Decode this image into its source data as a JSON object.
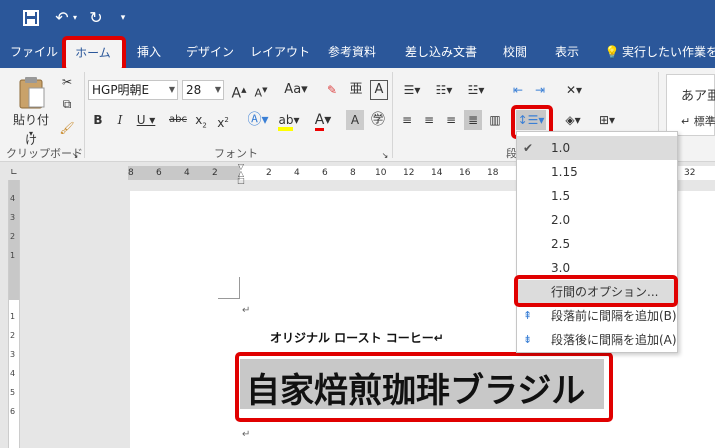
{
  "tabs": [
    "ファイル",
    "ホーム",
    "挿入",
    "デザイン",
    "レイアウト",
    "参考資料",
    "差し込み文書",
    "校閲",
    "表示"
  ],
  "tell_me": "実行したい作業を",
  "clipboard": {
    "paste_label": "貼り付け",
    "group_label": "クリップボード"
  },
  "font": {
    "name": "HGP明朝E",
    "size": "28",
    "group_label": "フォント"
  },
  "paragraph_group_label_partial": "段",
  "styles_preview": {
    "sample": "あア亜",
    "name": "↵ 標準"
  },
  "line_spacing_menu": {
    "options": [
      "1.0",
      "1.15",
      "1.5",
      "2.0",
      "2.5",
      "3.0"
    ],
    "checked": "1.0",
    "line_spacing_options": "行間のオプション...",
    "add_space_before": "段落前に間隔を追加(B)",
    "add_space_after": "段落後に間隔を追加(A)"
  },
  "ruler": {
    "top_left_numbers": [
      "8",
      "6",
      "4",
      "2"
    ],
    "top_right_numbers": [
      "2",
      "4",
      "6",
      "8",
      "10",
      "12",
      "14",
      "16",
      "18"
    ],
    "far_right": "32",
    "left_numbers": [
      "4",
      "3",
      "2",
      "1",
      "1",
      "2",
      "3",
      "4",
      "5",
      "6"
    ]
  },
  "document": {
    "subtitle": "オリジナル ロースト コーヒー↵",
    "title": "自家焙煎珈琲ブラジル",
    "para_mark": "↵"
  }
}
